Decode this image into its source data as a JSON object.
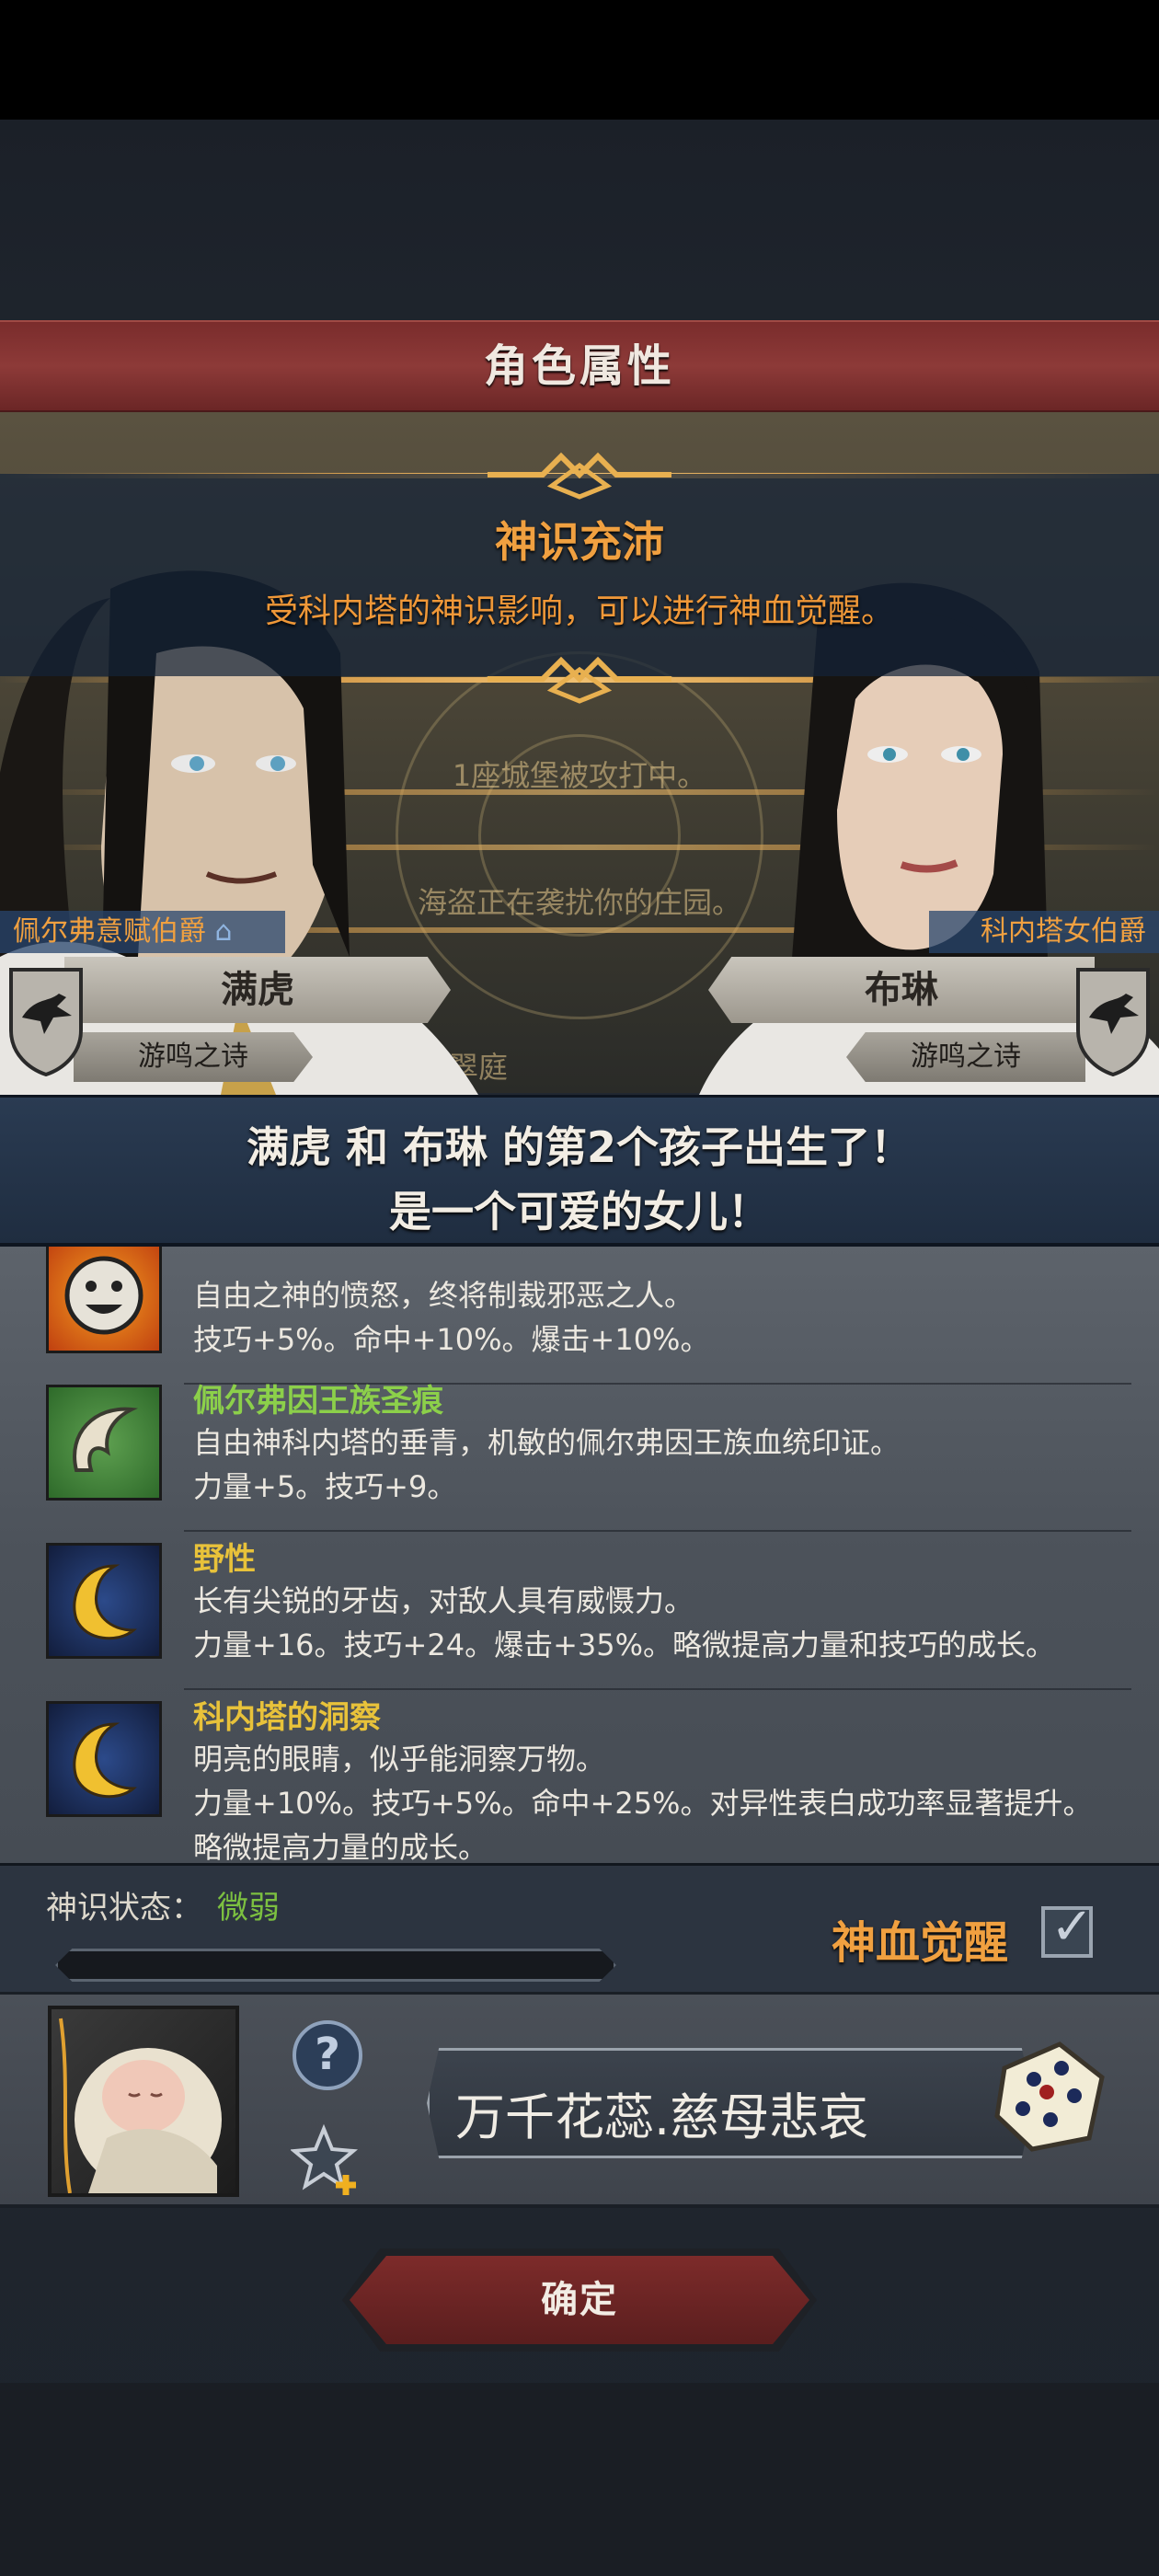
{
  "screen": {
    "title": "角色属性"
  },
  "notice": {
    "title": "神识充沛",
    "text": "受科内塔的神识影响，可以进行神血觉醒。"
  },
  "scene": {
    "line1": "1座城堡被攻打中。",
    "line2": "海盗正在袭扰你的庄园。",
    "line3": "翠庭"
  },
  "parents": {
    "left": {
      "title": "佩尔弗意赋伯爵",
      "name": "满虎",
      "house": "游鸣之诗"
    },
    "right": {
      "title": "科内塔女伯爵",
      "name": "布琳",
      "house": "游鸣之诗"
    }
  },
  "announcement": {
    "line1": "满虎 和 布琳 的第2个孩子出生了！",
    "line2": "是一个可爱的女儿！"
  },
  "traits": [
    {
      "name": "",
      "name_color": "#e8c23a",
      "icon": "smiley-face-icon",
      "desc": "自由之神的愤怒，终将制裁邪恶之人。",
      "stats": "技巧+5%。命中+10%。爆击+10%。",
      "stats2": ""
    },
    {
      "name": "佩尔弗因王族圣痕",
      "name_color": "#8cd04a",
      "icon": "feather-scroll-icon",
      "desc": "自由神科内塔的垂青，机敏的佩尔弗因王族血统印证。",
      "stats": "力量+5。技巧+9。",
      "stats2": ""
    },
    {
      "name": "野性",
      "name_color": "#e8c23a",
      "icon": "crescent-moon-icon",
      "desc": "长有尖锐的牙齿，对敌人具有威慑力。",
      "stats": "力量+16。技巧+24。爆击+35%。略微提高力量和技巧的成长。",
      "stats2": ""
    },
    {
      "name": "科内塔的洞察",
      "name_color": "#e8c23a",
      "icon": "crescent-moon-icon",
      "desc": "明亮的眼睛，似乎能洞察万物。",
      "stats": "力量+10%。技巧+5%。命中+25%。对异性表白成功率显著提升。",
      "stats2": "略微提高力量的成长。"
    }
  ],
  "status": {
    "label": "神识状态：",
    "value": "微弱",
    "progress": 0,
    "awaken_label": "神血觉醒",
    "awaken_checked": true
  },
  "child": {
    "help_icon": "question-mark-icon",
    "fav_icon": "star-plus-icon",
    "name": "万千花蕊.慈母悲哀",
    "dice_icon": "dice-icon"
  },
  "confirm_label": "确定",
  "colors": {
    "accent_orange": "#f0a040",
    "title_red": "#8d3a38",
    "green": "#7cc040"
  }
}
